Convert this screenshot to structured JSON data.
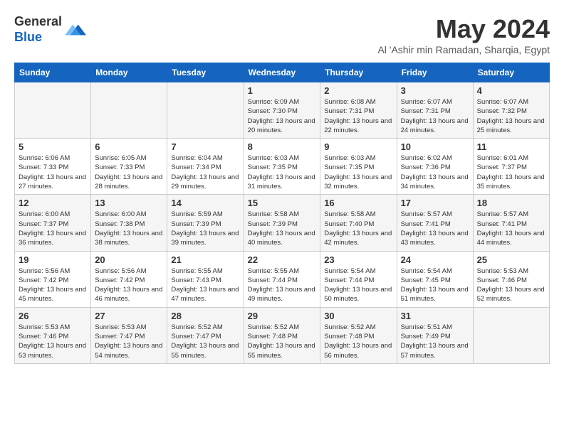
{
  "logo": {
    "line1": "General",
    "line2": "Blue"
  },
  "header": {
    "month": "May 2024",
    "location": "Al 'Ashir min Ramadan, Sharqia, Egypt"
  },
  "days_of_week": [
    "Sunday",
    "Monday",
    "Tuesday",
    "Wednesday",
    "Thursday",
    "Friday",
    "Saturday"
  ],
  "weeks": [
    [
      {
        "day": "",
        "info": ""
      },
      {
        "day": "",
        "info": ""
      },
      {
        "day": "",
        "info": ""
      },
      {
        "day": "1",
        "info": "Sunrise: 6:09 AM\nSunset: 7:30 PM\nDaylight: 13 hours and 20 minutes."
      },
      {
        "day": "2",
        "info": "Sunrise: 6:08 AM\nSunset: 7:31 PM\nDaylight: 13 hours and 22 minutes."
      },
      {
        "day": "3",
        "info": "Sunrise: 6:07 AM\nSunset: 7:31 PM\nDaylight: 13 hours and 24 minutes."
      },
      {
        "day": "4",
        "info": "Sunrise: 6:07 AM\nSunset: 7:32 PM\nDaylight: 13 hours and 25 minutes."
      }
    ],
    [
      {
        "day": "5",
        "info": "Sunrise: 6:06 AM\nSunset: 7:33 PM\nDaylight: 13 hours and 27 minutes."
      },
      {
        "day": "6",
        "info": "Sunrise: 6:05 AM\nSunset: 7:33 PM\nDaylight: 13 hours and 28 minutes."
      },
      {
        "day": "7",
        "info": "Sunrise: 6:04 AM\nSunset: 7:34 PM\nDaylight: 13 hours and 29 minutes."
      },
      {
        "day": "8",
        "info": "Sunrise: 6:03 AM\nSunset: 7:35 PM\nDaylight: 13 hours and 31 minutes."
      },
      {
        "day": "9",
        "info": "Sunrise: 6:03 AM\nSunset: 7:35 PM\nDaylight: 13 hours and 32 minutes."
      },
      {
        "day": "10",
        "info": "Sunrise: 6:02 AM\nSunset: 7:36 PM\nDaylight: 13 hours and 34 minutes."
      },
      {
        "day": "11",
        "info": "Sunrise: 6:01 AM\nSunset: 7:37 PM\nDaylight: 13 hours and 35 minutes."
      }
    ],
    [
      {
        "day": "12",
        "info": "Sunrise: 6:00 AM\nSunset: 7:37 PM\nDaylight: 13 hours and 36 minutes."
      },
      {
        "day": "13",
        "info": "Sunrise: 6:00 AM\nSunset: 7:38 PM\nDaylight: 13 hours and 38 minutes."
      },
      {
        "day": "14",
        "info": "Sunrise: 5:59 AM\nSunset: 7:39 PM\nDaylight: 13 hours and 39 minutes."
      },
      {
        "day": "15",
        "info": "Sunrise: 5:58 AM\nSunset: 7:39 PM\nDaylight: 13 hours and 40 minutes."
      },
      {
        "day": "16",
        "info": "Sunrise: 5:58 AM\nSunset: 7:40 PM\nDaylight: 13 hours and 42 minutes."
      },
      {
        "day": "17",
        "info": "Sunrise: 5:57 AM\nSunset: 7:41 PM\nDaylight: 13 hours and 43 minutes."
      },
      {
        "day": "18",
        "info": "Sunrise: 5:57 AM\nSunset: 7:41 PM\nDaylight: 13 hours and 44 minutes."
      }
    ],
    [
      {
        "day": "19",
        "info": "Sunrise: 5:56 AM\nSunset: 7:42 PM\nDaylight: 13 hours and 45 minutes."
      },
      {
        "day": "20",
        "info": "Sunrise: 5:56 AM\nSunset: 7:42 PM\nDaylight: 13 hours and 46 minutes."
      },
      {
        "day": "21",
        "info": "Sunrise: 5:55 AM\nSunset: 7:43 PM\nDaylight: 13 hours and 47 minutes."
      },
      {
        "day": "22",
        "info": "Sunrise: 5:55 AM\nSunset: 7:44 PM\nDaylight: 13 hours and 49 minutes."
      },
      {
        "day": "23",
        "info": "Sunrise: 5:54 AM\nSunset: 7:44 PM\nDaylight: 13 hours and 50 minutes."
      },
      {
        "day": "24",
        "info": "Sunrise: 5:54 AM\nSunset: 7:45 PM\nDaylight: 13 hours and 51 minutes."
      },
      {
        "day": "25",
        "info": "Sunrise: 5:53 AM\nSunset: 7:46 PM\nDaylight: 13 hours and 52 minutes."
      }
    ],
    [
      {
        "day": "26",
        "info": "Sunrise: 5:53 AM\nSunset: 7:46 PM\nDaylight: 13 hours and 53 minutes."
      },
      {
        "day": "27",
        "info": "Sunrise: 5:53 AM\nSunset: 7:47 PM\nDaylight: 13 hours and 54 minutes."
      },
      {
        "day": "28",
        "info": "Sunrise: 5:52 AM\nSunset: 7:47 PM\nDaylight: 13 hours and 55 minutes."
      },
      {
        "day": "29",
        "info": "Sunrise: 5:52 AM\nSunset: 7:48 PM\nDaylight: 13 hours and 55 minutes."
      },
      {
        "day": "30",
        "info": "Sunrise: 5:52 AM\nSunset: 7:48 PM\nDaylight: 13 hours and 56 minutes."
      },
      {
        "day": "31",
        "info": "Sunrise: 5:51 AM\nSunset: 7:49 PM\nDaylight: 13 hours and 57 minutes."
      },
      {
        "day": "",
        "info": ""
      }
    ]
  ]
}
